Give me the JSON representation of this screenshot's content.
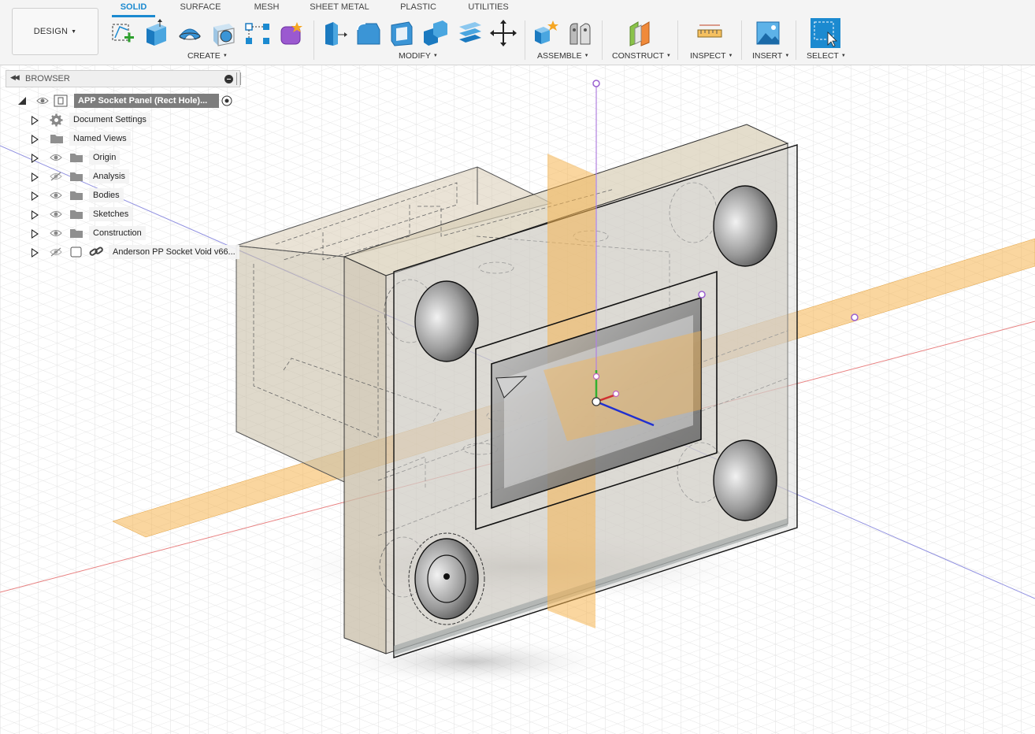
{
  "workspace": {
    "label": "DESIGN",
    "menu_icon": "caret-down-icon"
  },
  "tabs": [
    {
      "label": "SOLID",
      "active": true
    },
    {
      "label": "SURFACE",
      "active": false
    },
    {
      "label": "MESH",
      "active": false
    },
    {
      "label": "SHEET METAL",
      "active": false
    },
    {
      "label": "PLASTIC",
      "active": false
    },
    {
      "label": "UTILITIES",
      "active": false
    }
  ],
  "groups": {
    "create": {
      "label": "CREATE",
      "tools": [
        "create-sketch-icon",
        "extrude-icon",
        "revolve-icon",
        "hole-icon",
        "pattern-icon",
        "create-form-icon"
      ]
    },
    "modify": {
      "label": "MODIFY",
      "tools": [
        "press-pull-icon",
        "fillet-icon",
        "shell-icon",
        "combine-icon",
        "offset-face-icon",
        "move-icon"
      ]
    },
    "assemble": {
      "label": "ASSEMBLE",
      "tools": [
        "new-component-icon",
        "joint-icon"
      ]
    },
    "construct": {
      "label": "CONSTRUCT",
      "tools": [
        "offset-plane-icon"
      ]
    },
    "inspect": {
      "label": "INSPECT",
      "tools": [
        "measure-icon"
      ]
    },
    "insert": {
      "label": "INSERT",
      "tools": [
        "insert-image-icon"
      ]
    },
    "select": {
      "label": "SELECT",
      "tools": [
        "window-select-icon"
      ]
    }
  },
  "browser": {
    "title": "BROWSER",
    "root": {
      "label": "APP Socket Panel (Rect Hole)..."
    },
    "items": [
      {
        "label": "Document Settings",
        "icon": "gear-icon",
        "visibility": "none"
      },
      {
        "label": "Named Views",
        "icon": "folder-icon",
        "visibility": "none"
      },
      {
        "label": "Origin",
        "icon": "folder-icon",
        "visibility": "visible"
      },
      {
        "label": "Analysis",
        "icon": "folder-icon",
        "visibility": "hidden"
      },
      {
        "label": "Bodies",
        "icon": "folder-icon",
        "visibility": "visible"
      },
      {
        "label": "Sketches",
        "icon": "folder-icon",
        "visibility": "visible"
      },
      {
        "label": "Construction",
        "icon": "folder-icon",
        "visibility": "visible"
      },
      {
        "label": "Anderson PP Socket Void v66...",
        "icon": "component-icon",
        "visibility": "hidden"
      }
    ]
  },
  "colors": {
    "accent": "#1b8ad0",
    "construction_plane": "#f5b451",
    "axis_x": "#e04040",
    "axis_y": "#40b040",
    "axis_z": "#2040d0",
    "origin_point": "#b080e0"
  }
}
